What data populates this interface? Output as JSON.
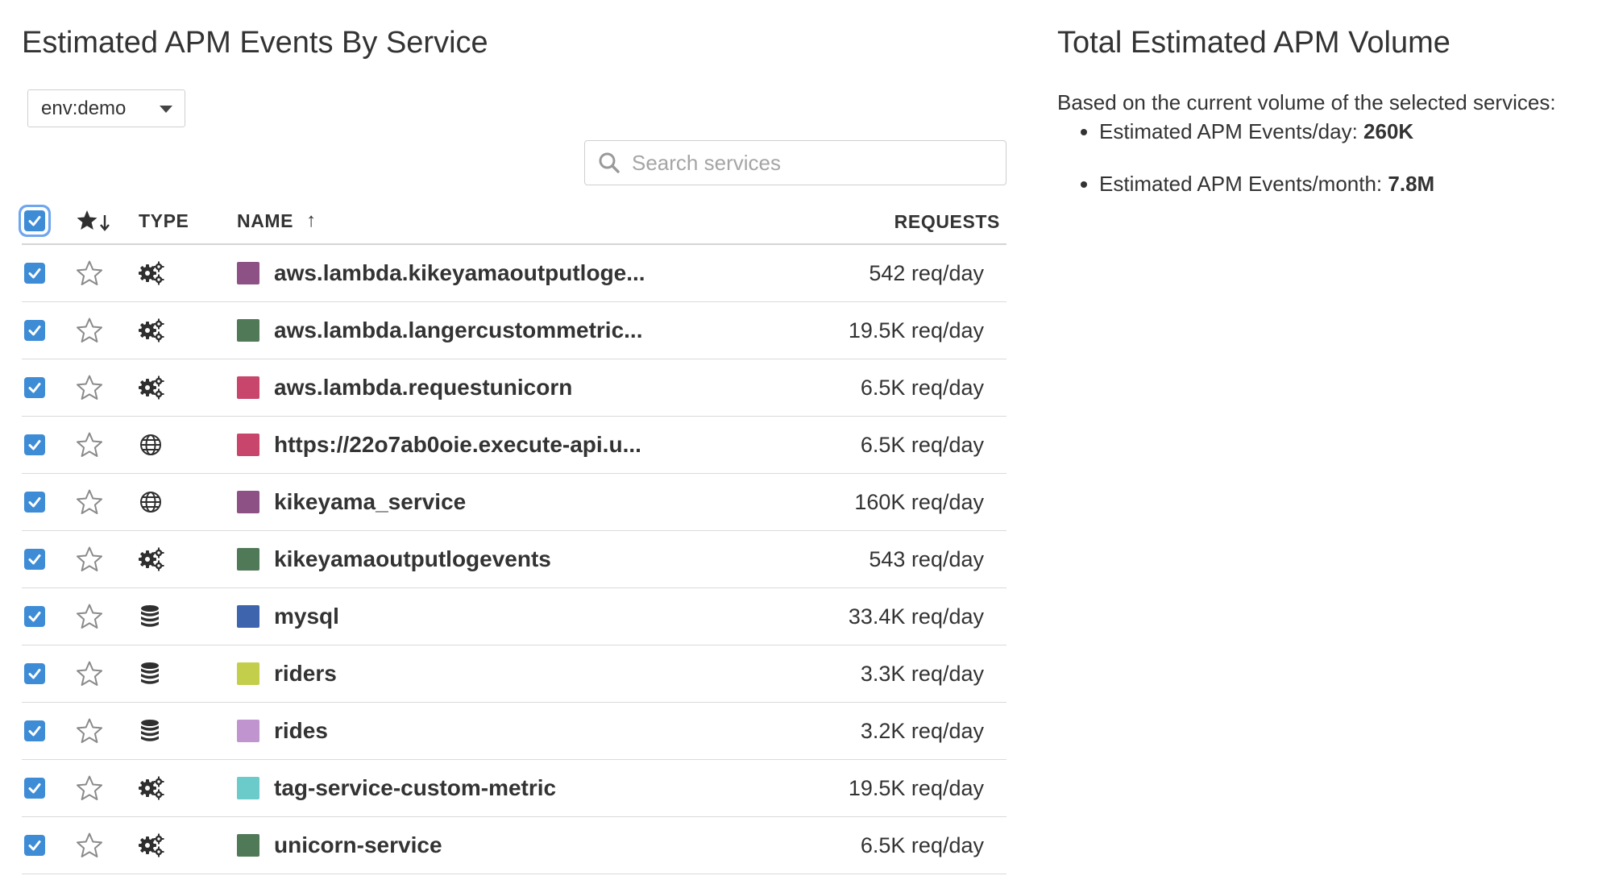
{
  "left": {
    "title": "Estimated APM Events By Service",
    "env_filter": "env:demo",
    "search": {
      "placeholder": "Search services",
      "value": ""
    },
    "columns": {
      "type": "TYPE",
      "name": "NAME",
      "name_sort": "↑",
      "requests": "REQUESTS"
    },
    "rows": [
      {
        "name": "aws.lambda.kikeyamaoutputloge...",
        "type": "service",
        "color": "#8e5185",
        "requests": "542 req/day"
      },
      {
        "name": "aws.lambda.langercustommetric...",
        "type": "service",
        "color": "#507958",
        "requests": "19.5K req/day"
      },
      {
        "name": "aws.lambda.requestunicorn",
        "type": "service",
        "color": "#c8456c",
        "requests": "6.5K req/day"
      },
      {
        "name": "https://22o7ab0oie.execute-api.u...",
        "type": "web",
        "color": "#c8456c",
        "requests": "6.5K req/day"
      },
      {
        "name": "kikeyama_service",
        "type": "web",
        "color": "#8e5185",
        "requests": "160K req/day"
      },
      {
        "name": "kikeyamaoutputlogevents",
        "type": "service",
        "color": "#507958",
        "requests": "543 req/day"
      },
      {
        "name": "mysql",
        "type": "db",
        "color": "#3d64ad",
        "requests": "33.4K req/day"
      },
      {
        "name": "riders",
        "type": "db",
        "color": "#c3ce4a",
        "requests": "3.3K req/day"
      },
      {
        "name": "rides",
        "type": "db",
        "color": "#c094cf",
        "requests": "3.2K req/day"
      },
      {
        "name": "tag-service-custom-metric",
        "type": "service",
        "color": "#6bcaca",
        "requests": "19.5K req/day"
      },
      {
        "name": "unicorn-service",
        "type": "service",
        "color": "#507958",
        "requests": "6.5K req/day"
      }
    ]
  },
  "right": {
    "title": "Total Estimated APM Volume",
    "description": "Based on the current volume of the selected services:",
    "day_label": "Estimated APM Events/day: ",
    "day_value": "260K",
    "month_label": "Estimated APM Events/month: ",
    "month_value": "7.8M"
  },
  "colors": {
    "checkbox": "#3e8cd6",
    "focus_ring": "#6fa6ef"
  },
  "icons": {
    "star": "star-outline-icon",
    "sort": "star-sort-icon",
    "service": "gears-icon",
    "web": "globe-icon",
    "db": "database-icon"
  }
}
